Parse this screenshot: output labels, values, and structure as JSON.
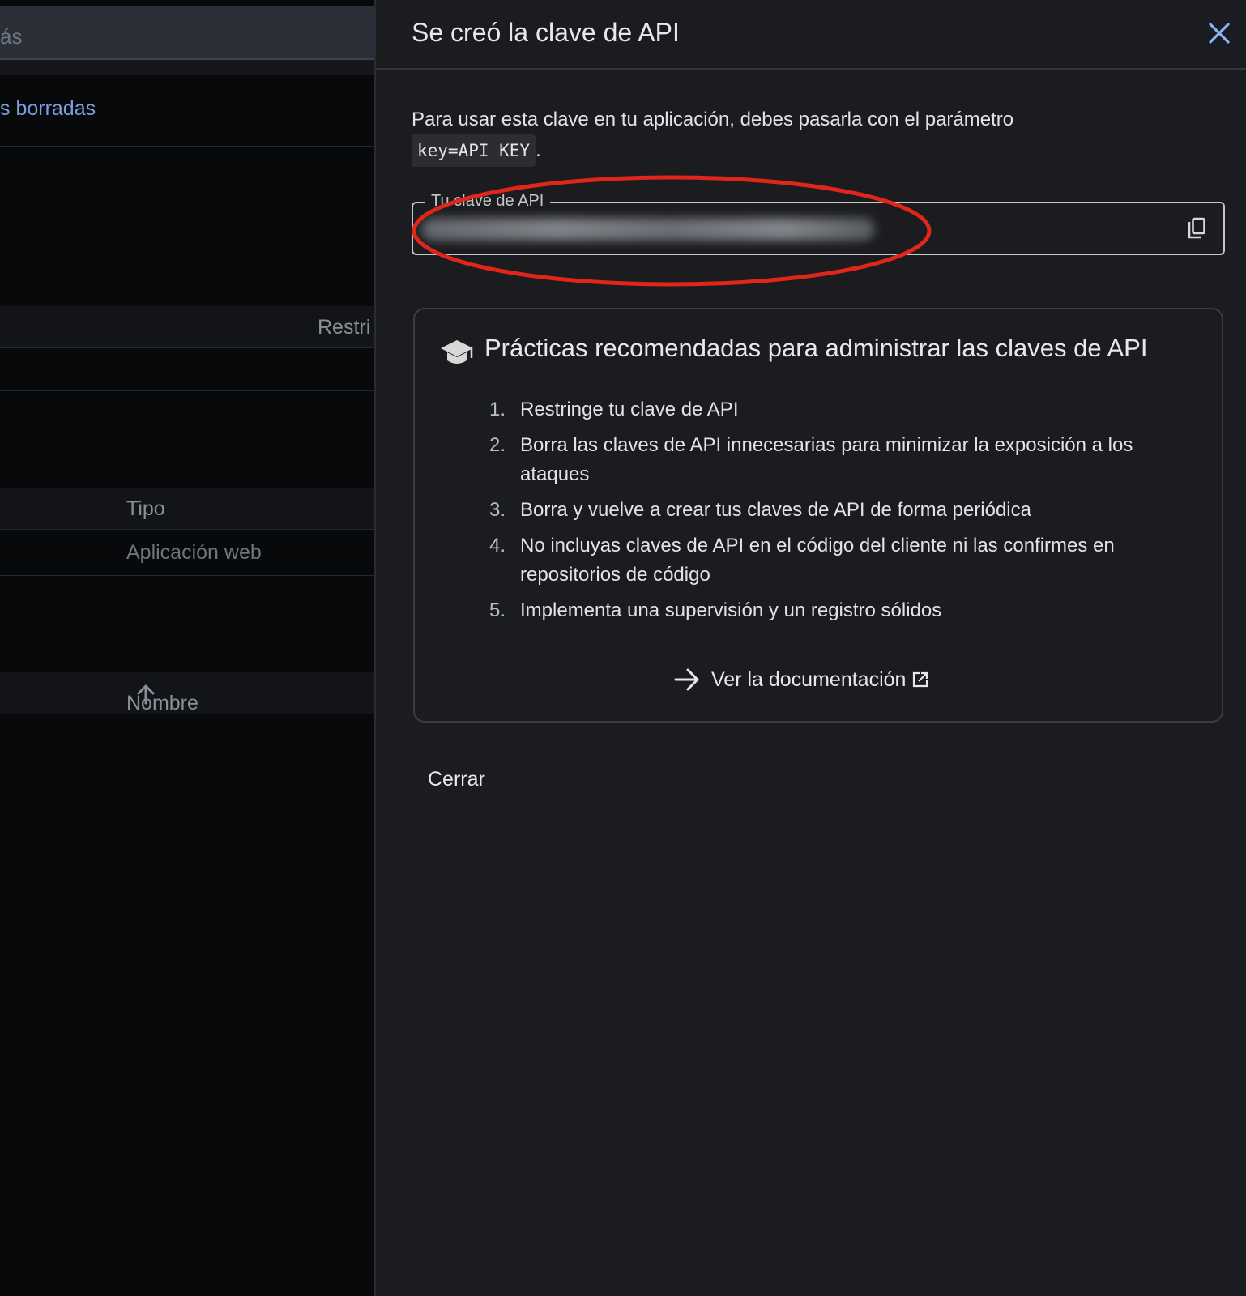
{
  "background": {
    "search_partial_text": "ás",
    "deleted_link_partial": "s borradas",
    "restrictions_header_partial": "Restri",
    "type_header": "Tipo",
    "type_value": "Aplicación web",
    "name_header": "Nombre",
    "sort_icon": "arrow-up-icon"
  },
  "dialog": {
    "title": "Se creó la clave de API",
    "close_icon": "close-icon",
    "intro_text": "Para usar esta clave en tu aplicación, debes pasarla con el parámetro",
    "intro_code": "key=API_KEY",
    "intro_suffix": ".",
    "api_key_field": {
      "label": "Tu clave de API",
      "value_state": "blurred",
      "copy_icon": "copy-icon"
    },
    "annotation": {
      "shape": "ellipse",
      "color": "#e0251b"
    },
    "best_practices": {
      "icon": "graduation-cap-icon",
      "title": "Prácticas recomendadas para administrar las claves de API",
      "items": [
        {
          "num": "1.",
          "text": "Restringe tu clave de API"
        },
        {
          "num": "2.",
          "text": "Borra las claves de API innecesarias para minimizar la exposición a los ataques"
        },
        {
          "num": "3.",
          "text": "Borra y vuelve a crear tus claves de API de forma periódica"
        },
        {
          "num": "4.",
          "text": "No incluyas claves de API en el código del cliente ni las confirmes en repositorios de código"
        },
        {
          "num": "5.",
          "text": "Implementa una supervisión y un registro sólidos"
        }
      ],
      "docs_link": "Ver la documentación",
      "docs_icon": "arrow-right-icon",
      "external_icon": "open-in-new-icon"
    },
    "close_button": "Cerrar"
  },
  "colors": {
    "panel_bg": "#1b1c20",
    "page_bg": "#08090b",
    "accent_link": "#7a9fe0",
    "close_icon": "#8ab4f8",
    "annotation_red": "#e0251b"
  }
}
